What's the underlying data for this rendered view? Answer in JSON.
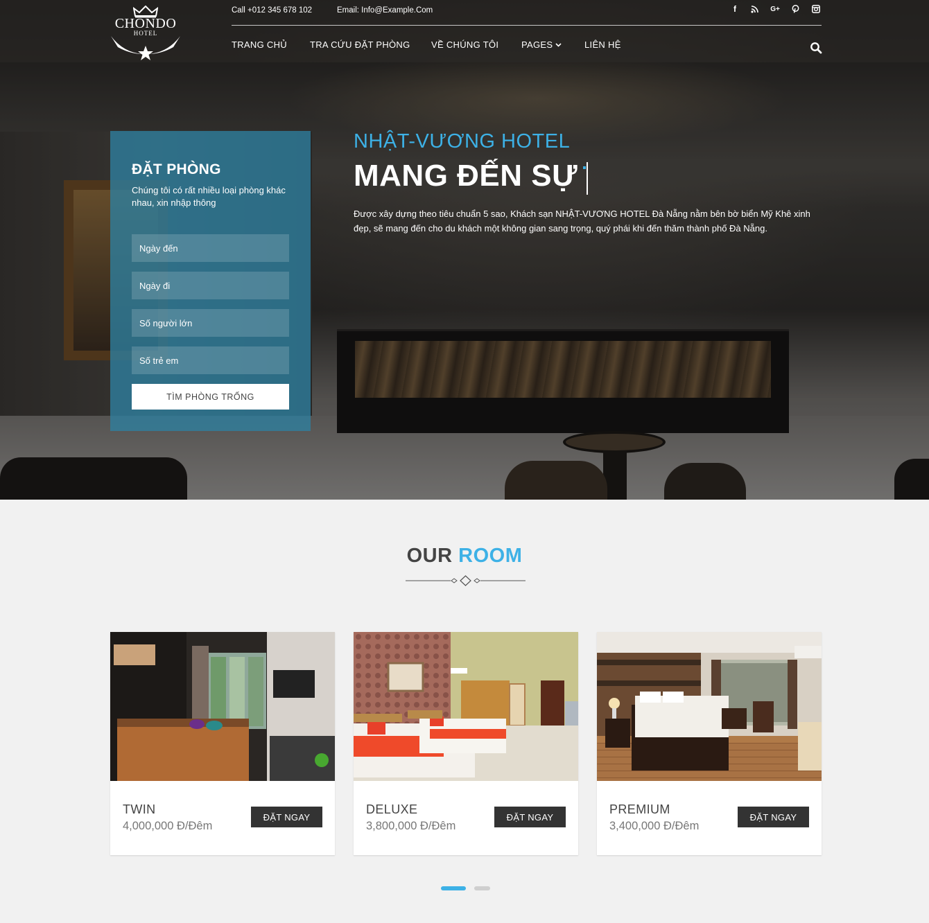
{
  "header": {
    "logo_name": "CHONDO",
    "logo_sub": "HOTEL",
    "phone": "Call +012 345 678 102",
    "email": "Email: Info@Example.Com",
    "social_icons": [
      "facebook-icon",
      "rss-icon",
      "google-plus-icon",
      "pinterest-icon",
      "instagram-icon"
    ],
    "social_glyphs": [
      "f",
      "∷",
      "G+",
      "Ⓟ",
      "▣"
    ],
    "nav": [
      "TRANG CHỦ",
      "TRA CỨU ĐẶT PHÒNG",
      "VỀ CHÚNG TÔI",
      "PAGES",
      "LIÊN HỆ"
    ]
  },
  "booking": {
    "title": "ĐẶT PHÒNG",
    "description": "Chúng tôi có rất nhiều loại phòng khác nhau, xin nhập thông",
    "fields": [
      "Ngày đến",
      "Ngày đi",
      "Số người lớn",
      "Số trẻ em"
    ],
    "submit_label": "TÌM PHÒNG TRỐNG"
  },
  "hero": {
    "subtitle": "NHẬT-VƯƠNG HOTEL",
    "title": "MANG ĐẾN SỰ",
    "description": "Được xây dựng theo tiêu chuẩn 5 sao, Khách sạn NHẬT-VƯƠNG HOTEL Đà Nẵng nằm bên bờ biển Mỹ Khê xinh đẹp, sẽ mang đến cho du khách một không gian sang trọng, quý phái khi đến thăm thành phố Đà Nẵng."
  },
  "rooms_section": {
    "title_part1": "OUR",
    "title_part2": "ROOM",
    "rooms": [
      {
        "name": "TWIN",
        "price": "4,000,000 Đ/Đêm",
        "button": "ĐẶT NGAY"
      },
      {
        "name": "DELUXE",
        "price": "3,800,000 Đ/Đêm",
        "button": "ĐẶT NGAY"
      },
      {
        "name": "PREMIUM",
        "price": "3,400,000 Đ/Đêm",
        "button": "ĐẶT NGAY"
      }
    ],
    "carousel": {
      "active_index": 0,
      "total_pages": 2
    }
  },
  "colors": {
    "accent": "#3db1e6",
    "booking_panel": "#2e80a0",
    "button_dark": "#333333"
  }
}
